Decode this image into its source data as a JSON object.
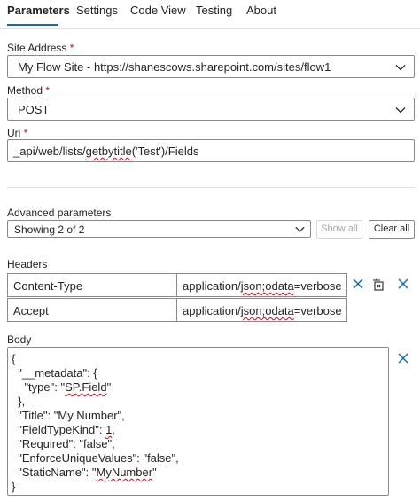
{
  "tabs": [
    {
      "label": "Parameters",
      "active": true
    },
    {
      "label": "Settings",
      "active": false
    },
    {
      "label": "Code View",
      "active": false
    },
    {
      "label": "Testing",
      "active": false
    },
    {
      "label": "About",
      "active": false
    }
  ],
  "site_address": {
    "label": "Site Address",
    "required_marker": "*",
    "value": "My Flow Site - https://shanescows.sharepoint.com/sites/flow1"
  },
  "method": {
    "label": "Method",
    "required_marker": "*",
    "value": "POST"
  },
  "uri": {
    "label": "Uri",
    "required_marker": "*",
    "value_prefix": "_api/web/lists/",
    "value_squiggle": "getbytitle",
    "value_suffix": "('Test')/Fields"
  },
  "advanced": {
    "label": "Advanced parameters",
    "selector_value": "Showing 2 of 2",
    "show_all_label": "Show all",
    "clear_all_label": "Clear all"
  },
  "headers": {
    "label": "Headers",
    "rows": [
      {
        "key": "Content-Type",
        "value_pre": "application/",
        "value_squiggle": "json;odata",
        "value_post": "=verbose"
      },
      {
        "key": "Accept",
        "value_pre": "application/",
        "value_squiggle": "json;odata",
        "value_post": "=verbose"
      }
    ]
  },
  "body": {
    "label": "Body",
    "lines": [
      {
        "pre": "{",
        "sq": "",
        "post": ""
      },
      {
        "pre": "  \"__metadata\": {",
        "sq": "",
        "post": ""
      },
      {
        "pre": "    \"type\": \"",
        "sq": "SP.Field",
        "post": "\""
      },
      {
        "pre": "  },",
        "sq": "",
        "post": ""
      },
      {
        "pre": "  \"Title\": \"My Number\",",
        "sq": "",
        "post": ""
      },
      {
        "pre": "  \"FieldTypeKind\": ",
        "sq": "1",
        "post": ","
      },
      {
        "pre": "  \"Required\": \"false\",",
        "sq": "",
        "post": ""
      },
      {
        "pre": "  \"EnforceUniqueValues\": \"false\",",
        "sq": "",
        "post": ""
      },
      {
        "pre": "  \"StaticName\": \"",
        "sq": "MyNumber",
        "post": "\""
      },
      {
        "pre": "}",
        "sq": "",
        "post": ""
      }
    ]
  },
  "colors": {
    "accent": "#0f6cbd",
    "required": "#c50f1f",
    "border": "#8a8a8a"
  }
}
